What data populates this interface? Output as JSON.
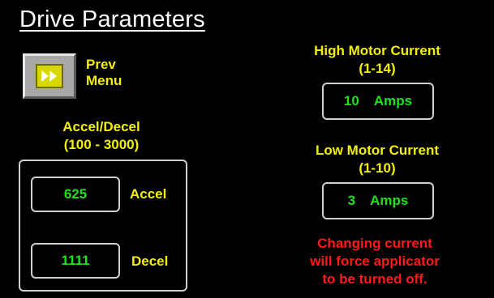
{
  "screen": {
    "title": "Drive Parameters"
  },
  "prev_menu": {
    "icon": "fast-forward-icon",
    "label_line1": "Prev",
    "label_line2": "Menu"
  },
  "accel_decel": {
    "heading": "Accel/Decel",
    "range": "(100 - 3000)",
    "accel_value": "625",
    "accel_label": "Accel",
    "decel_value": "1111",
    "decel_label": "Decel"
  },
  "high_motor_current": {
    "heading": "High Motor Current",
    "range": "(1-14)",
    "value": "10",
    "unit": "Amps"
  },
  "low_motor_current": {
    "heading": "Low Motor Current",
    "range": "(1-10)",
    "value": "3",
    "unit": "Amps"
  },
  "warning": {
    "line1": "Changing current",
    "line2": "will force applicator",
    "line3": "to be turned off."
  },
  "colors": {
    "background": "#000000",
    "label_yellow": "#f5f000",
    "value_green": "#22e020",
    "warning_red": "#ff1a1a",
    "title_white": "#ffffff"
  }
}
